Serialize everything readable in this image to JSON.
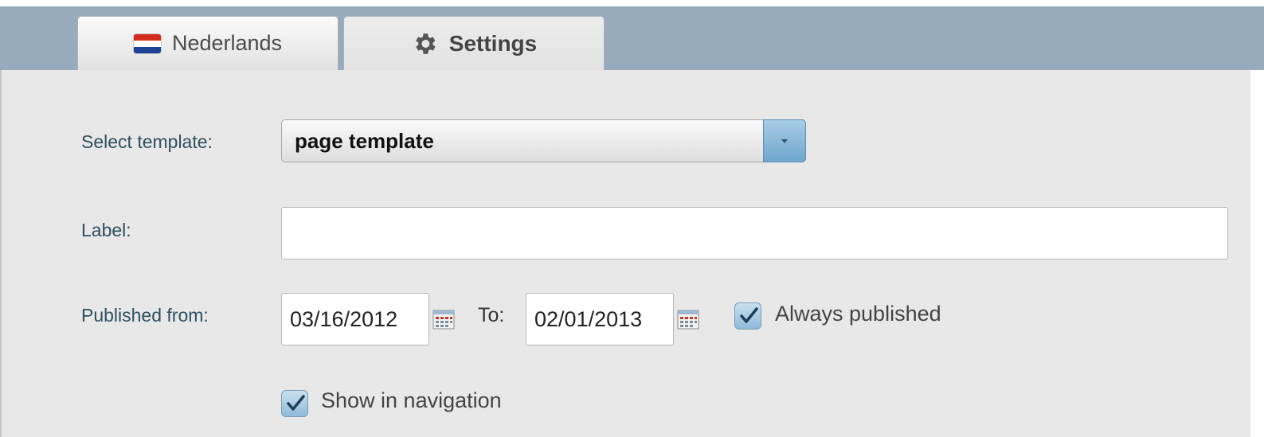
{
  "tabs": [
    {
      "label": "Nederlands",
      "icon": "netherlands-flag-icon"
    },
    {
      "label": "Settings",
      "icon": "gear-icon"
    }
  ],
  "form": {
    "template_label": "Select template:",
    "template_value": "page template",
    "label_label": "Label:",
    "label_value": "",
    "published_from_label": "Published from:",
    "published_from_value": "03/16/2012",
    "to_label": "To:",
    "published_to_value": "02/01/2013",
    "always_published_label": "Always published",
    "always_published_checked": true,
    "show_in_navigation_label": "Show in navigation",
    "show_in_navigation_checked": true
  },
  "colors": {
    "header": "#97abbd",
    "panel": "#e8e8e8",
    "accent": "#8fbbd9",
    "label_text": "#2f4f5f"
  }
}
